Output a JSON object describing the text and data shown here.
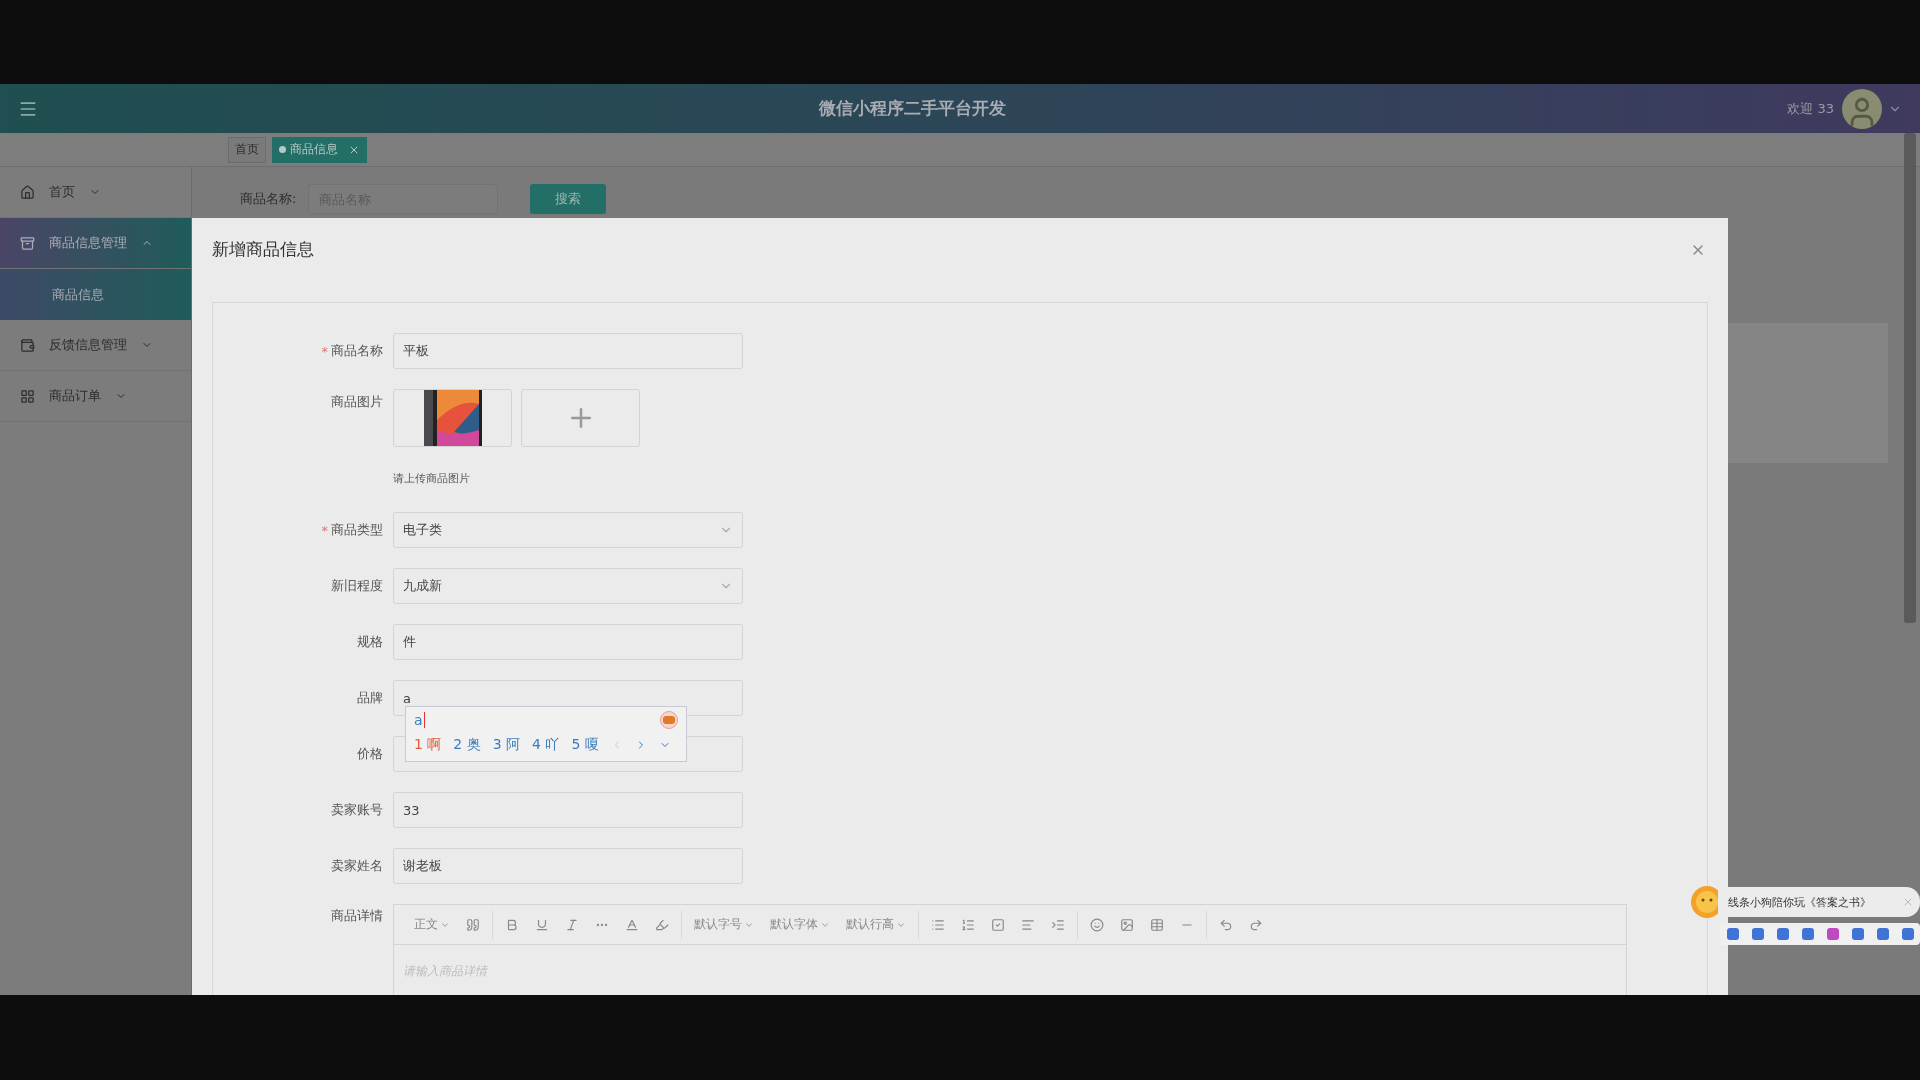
{
  "header": {
    "title": "微信小程序二手平台开发",
    "greeting": "欢迎 33"
  },
  "tabs": [
    {
      "label": "首页",
      "selected": false
    },
    {
      "label": "商品信息",
      "selected": true
    }
  ],
  "sidebar": {
    "items": [
      {
        "label": "首页",
        "expanded": false,
        "selected": false
      },
      {
        "label": "商品信息管理",
        "expanded": true,
        "selected": true,
        "children": [
          {
            "label": "商品信息"
          }
        ]
      },
      {
        "label": "反馈信息管理",
        "expanded": false,
        "selected": false
      },
      {
        "label": "商品订单",
        "expanded": false,
        "selected": false
      }
    ]
  },
  "search": {
    "label": "商品名称:",
    "placeholder": "商品名称",
    "button": "搜索"
  },
  "dialog": {
    "title": "新增商品信息",
    "fields": [
      {
        "kind": "text",
        "label": "商品名称",
        "marker": "*",
        "value": "平板"
      },
      {
        "kind": "upload",
        "label": "商品图片",
        "hint": "请上传商品图片"
      },
      {
        "kind": "select",
        "label": "商品类型",
        "marker": "*",
        "value": "电子类"
      },
      {
        "kind": "select",
        "label": "新旧程度",
        "value": "九成新"
      },
      {
        "kind": "text",
        "label": "规格",
        "value": "件"
      },
      {
        "kind": "text",
        "label": "品牌",
        "value": "a",
        "ime": true
      },
      {
        "kind": "text",
        "label": "价格"
      },
      {
        "kind": "text",
        "label": "卖家账号",
        "value": "33"
      },
      {
        "kind": "text",
        "label": "卖家姓名",
        "value": "谢老板"
      },
      {
        "kind": "editor",
        "label": "商品详情",
        "placeholder": "请输入商品详情",
        "toolbar": {
          "format": "正文",
          "font_size": "默认字号",
          "font_family": "默认字体",
          "line_height": "默认行高"
        }
      }
    ]
  },
  "ime": {
    "composition": "a",
    "candidates": [
      {
        "text": "1 啊",
        "selected": true
      },
      {
        "text": "2 奥",
        "selected": false
      },
      {
        "text": "3 阿",
        "selected": false
      },
      {
        "text": "4 吖",
        "selected": false
      },
      {
        "text": "5 嗄",
        "selected": false
      }
    ]
  },
  "notification": {
    "text": "线条小狗陪你玩《答案之书》"
  }
}
